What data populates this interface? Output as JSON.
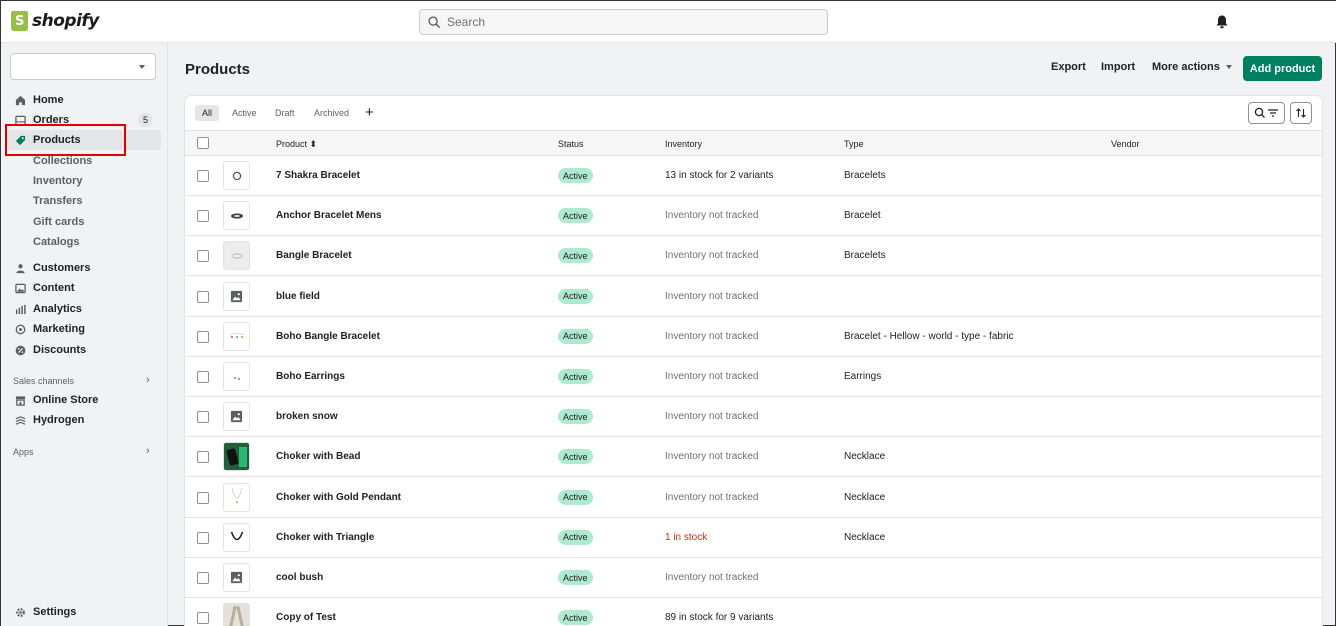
{
  "brand": {
    "name": "shopify"
  },
  "search": {
    "placeholder": "Search"
  },
  "sidebar": {
    "store_select_value": "",
    "items": [
      {
        "label": "Home",
        "icon": "home-icon"
      },
      {
        "label": "Orders",
        "icon": "orders-icon",
        "badge": "5"
      },
      {
        "label": "Products",
        "icon": "tag-icon",
        "active": true
      },
      {
        "label": "Customers",
        "icon": "person-icon"
      },
      {
        "label": "Content",
        "icon": "image-icon"
      },
      {
        "label": "Analytics",
        "icon": "bar-chart-icon"
      },
      {
        "label": "Marketing",
        "icon": "target-icon"
      },
      {
        "label": "Discounts",
        "icon": "discount-icon"
      }
    ],
    "product_subitems": [
      "Collections",
      "Inventory",
      "Transfers",
      "Gift cards",
      "Catalogs"
    ],
    "sales_channels_label": "Sales channels",
    "sales_channels": [
      {
        "label": "Online Store",
        "icon": "store-icon"
      },
      {
        "label": "Hydrogen",
        "icon": "hydrogen-icon"
      }
    ],
    "apps_label": "Apps",
    "settings_label": "Settings"
  },
  "page": {
    "title": "Products",
    "export_label": "Export",
    "import_label": "Import",
    "more_actions_label": "More actions",
    "add_product_label": "Add product"
  },
  "tabs": [
    "All",
    "Active",
    "Draft",
    "Archived"
  ],
  "table": {
    "columns": {
      "product": "Product",
      "status": "Status",
      "inventory": "Inventory",
      "type": "Type",
      "vendor": "Vendor"
    },
    "sort_indicator": "⬍",
    "rows": [
      {
        "name": "7 Shakra Bracelet",
        "status": "Active",
        "inventory": "13 in stock for 2 variants",
        "inv_kind": "instock",
        "type": "Bracelets",
        "thumb": "bracelet-ring"
      },
      {
        "name": "Anchor Bracelet Mens",
        "status": "Active",
        "inventory": "Inventory not tracked",
        "inv_kind": "untracked",
        "type": "Bracelet",
        "thumb": "bracelet-dark"
      },
      {
        "name": "Bangle Bracelet",
        "status": "Active",
        "inventory": "Inventory not tracked",
        "inv_kind": "untracked",
        "type": "Bracelets",
        "thumb": "bangle"
      },
      {
        "name": "blue field",
        "status": "Active",
        "inventory": "Inventory not tracked",
        "inv_kind": "untracked",
        "type": "",
        "thumb": "placeholder"
      },
      {
        "name": "Boho Bangle Bracelet",
        "status": "Active",
        "inventory": "Inventory not tracked",
        "inv_kind": "untracked",
        "type": "Bracelet - Hellow - world - type - fabric",
        "thumb": "boho"
      },
      {
        "name": "Boho Earrings",
        "status": "Active",
        "inventory": "Inventory not tracked",
        "inv_kind": "untracked",
        "type": "Earrings",
        "thumb": "earrings"
      },
      {
        "name": "broken snow",
        "status": "Active",
        "inventory": "Inventory not tracked",
        "inv_kind": "untracked",
        "type": "",
        "thumb": "placeholder"
      },
      {
        "name": "Choker with Bead",
        "status": "Active",
        "inventory": "Inventory not tracked",
        "inv_kind": "untracked",
        "type": "Necklace",
        "thumb": "choker-photo"
      },
      {
        "name": "Choker with Gold Pendant",
        "status": "Active",
        "inventory": "Inventory not tracked",
        "inv_kind": "untracked",
        "type": "Necklace",
        "thumb": "pendant"
      },
      {
        "name": "Choker with Triangle",
        "status": "Active",
        "inventory": "1 in stock",
        "inv_kind": "low",
        "type": "Necklace",
        "thumb": "choker-u"
      },
      {
        "name": "cool bush",
        "status": "Active",
        "inventory": "Inventory not tracked",
        "inv_kind": "untracked",
        "type": "",
        "thumb": "placeholder"
      },
      {
        "name": "Copy of Test",
        "status": "Active",
        "inventory": "89 in stock for 9 variants",
        "inv_kind": "instock",
        "type": "",
        "thumb": "test-photo"
      }
    ]
  },
  "colors": {
    "primary": "#008060",
    "active_badge": "#aee9d1",
    "highlight_box": "#e00000",
    "critical": "#d72c0d"
  }
}
